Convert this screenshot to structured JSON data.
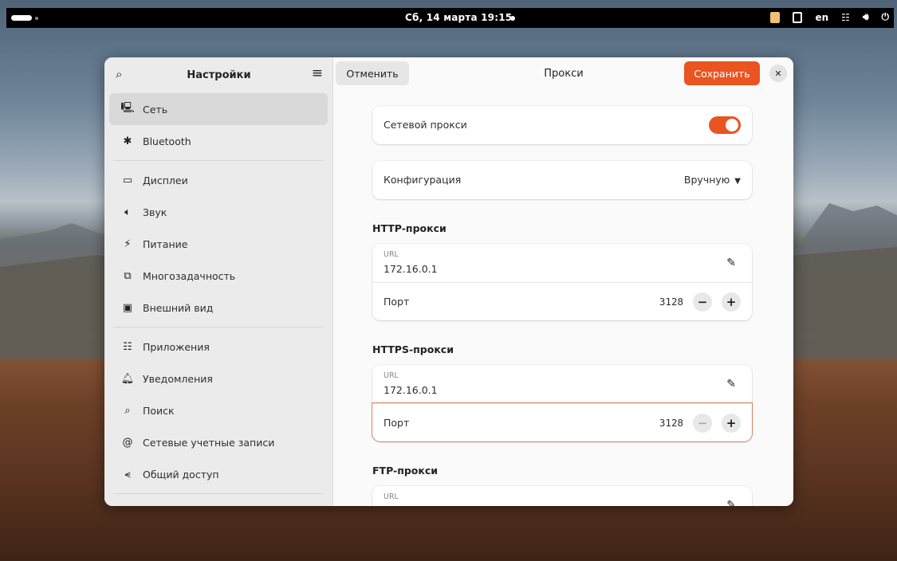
{
  "topbar": {
    "clock": "Сб, 14 марта 19:15",
    "keyboard_layout": "en",
    "icons": [
      "notes-icon",
      "clipboard-icon",
      "network-icon",
      "volume-icon",
      "power-icon"
    ]
  },
  "sidebar": {
    "title": "Настройки",
    "items": [
      {
        "label": "Сеть",
        "icon": "network-icon",
        "active": true
      },
      {
        "label": "Bluetooth",
        "icon": "bluetooth-icon"
      },
      {
        "label": "Дисплеи",
        "icon": "display-icon"
      },
      {
        "label": "Звук",
        "icon": "sound-icon"
      },
      {
        "label": "Питание",
        "icon": "power-icon"
      },
      {
        "label": "Многозадачность",
        "icon": "multitasking-icon"
      },
      {
        "label": "Внешний вид",
        "icon": "appearance-icon"
      },
      {
        "label": "Приложения",
        "icon": "apps-icon"
      },
      {
        "label": "Уведомления",
        "icon": "bell-icon"
      },
      {
        "label": "Поиск",
        "icon": "search-icon"
      },
      {
        "label": "Сетевые учетные записи",
        "icon": "at-icon"
      },
      {
        "label": "Общий доступ",
        "icon": "share-icon"
      }
    ]
  },
  "header": {
    "cancel_label": "Отменить",
    "title": "Прокси",
    "save_label": "Сохранить"
  },
  "proxy": {
    "network_proxy_label": "Сетевой прокси",
    "network_proxy_enabled": true,
    "config_label": "Конфигурация",
    "config_value": "Вручную",
    "http": {
      "title": "HTTP-прокси",
      "url_label": "URL",
      "url": "172.16.0.1",
      "port_label": "Порт",
      "port": "3128"
    },
    "https": {
      "title": "HTTPS-прокси",
      "url_label": "URL",
      "url": "172.16.0.1",
      "port_label": "Порт",
      "port": "3128"
    },
    "ftp": {
      "title": "FTP-прокси",
      "url_label": "URL"
    }
  },
  "colors": {
    "accent": "#e95420"
  }
}
